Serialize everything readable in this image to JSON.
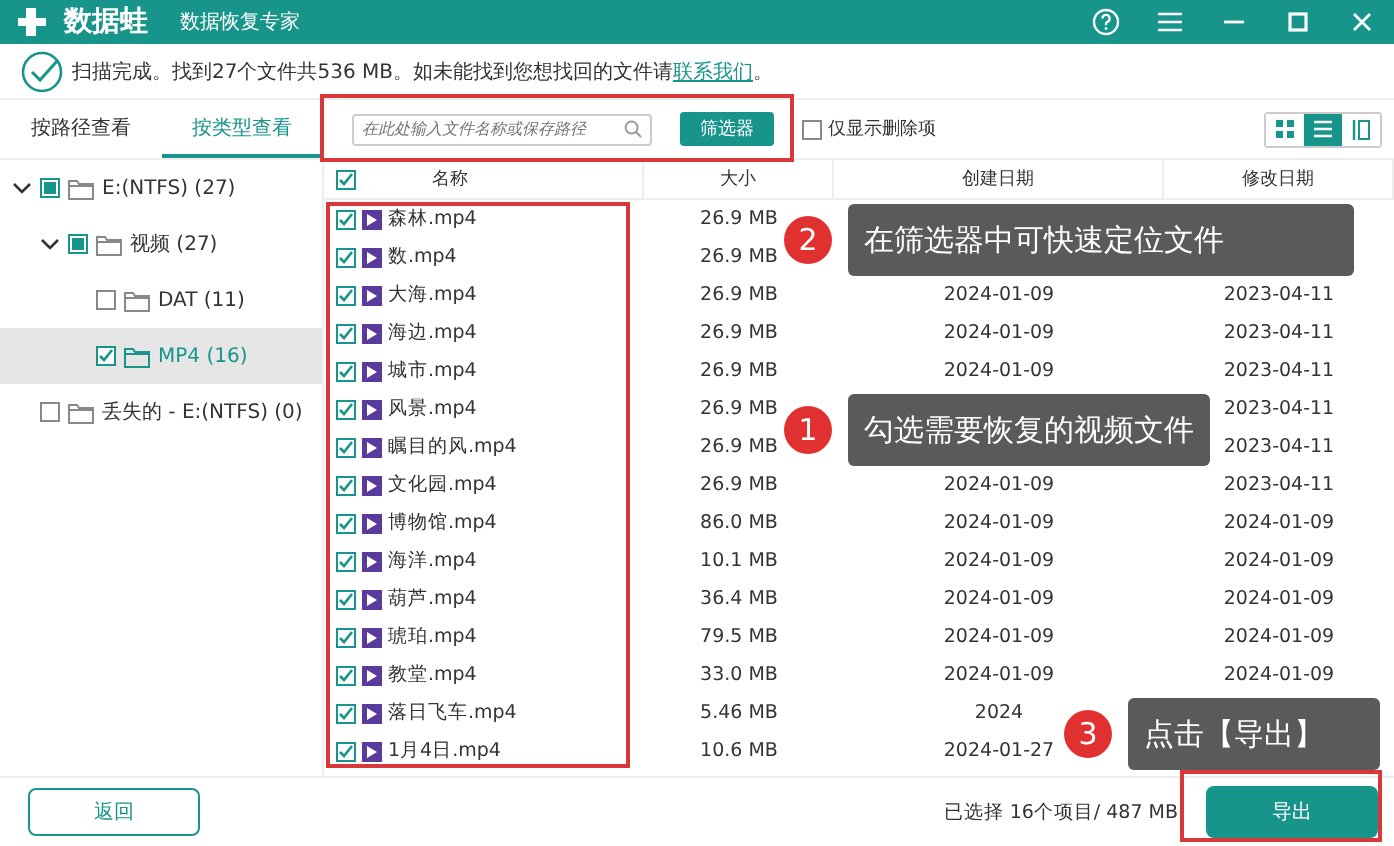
{
  "title_bar": {
    "app_name": "数据蛙",
    "subtitle": "数据恢复专家"
  },
  "status": {
    "text": "扫描完成。找到27个文件共536 MB。如未能找到您想找回的文件请",
    "link": "联系我们",
    "end": "。"
  },
  "view_tabs": [
    {
      "label": "按路径查看",
      "selected": false
    },
    {
      "label": "按类型查看",
      "selected": true
    }
  ],
  "tree": [
    {
      "label": "E:(NTFS) (27)",
      "checked": false,
      "partial": true,
      "expanded": true,
      "selected": false,
      "children": [
        {
          "label": "视频 (27)",
          "checked": false,
          "partial": true,
          "expanded": true,
          "selected": false,
          "children": [
            {
              "label": "DAT (11)",
              "checked": false,
              "partial": false,
              "selected": false
            },
            {
              "label": "MP4 (16)",
              "checked": true,
              "partial": false,
              "selected": true
            }
          ]
        }
      ]
    },
    {
      "label": "丢失的 - E:(NTFS) (0)",
      "checked": false,
      "partial": false,
      "selected": false
    }
  ],
  "filter": {
    "placeholder": "在此处输入文件名称或保存路径",
    "button": "筛选器",
    "only_deleted": {
      "label": "仅显示删除项",
      "checked": false
    }
  },
  "view_modes": [
    {
      "kind": "grid",
      "selected": false
    },
    {
      "kind": "list",
      "selected": true
    },
    {
      "kind": "detail",
      "selected": false
    }
  ],
  "table": {
    "select_all": true,
    "columns": [
      "名称",
      "大小",
      "创建日期",
      "修改日期"
    ],
    "rows": [
      {
        "name": "森林.mp4",
        "checked": true,
        "size": "26.9 MB"
      },
      {
        "name": "数.mp4",
        "checked": true,
        "size": "26.9 MB"
      },
      {
        "name": "大海.mp4",
        "checked": true,
        "size": "26.9 MB",
        "created": "2024-01-09",
        "modified": "2023-04-11"
      },
      {
        "name": "海边.mp4",
        "checked": true,
        "size": "26.9 MB",
        "created": "2024-01-09",
        "modified": "2023-04-11"
      },
      {
        "name": "城市.mp4",
        "checked": true,
        "size": "26.9 MB",
        "created": "2024-01-09",
        "modified": "2023-04-11"
      },
      {
        "name": "风景.mp4",
        "checked": true,
        "size": "26.9 MB",
        "modified": "2023-04-11"
      },
      {
        "name": "瞩目的风.mp4",
        "checked": true,
        "size": "26.9 MB",
        "modified": "2023-04-11"
      },
      {
        "name": "文化园.mp4",
        "checked": true,
        "size": "26.9 MB",
        "created": "2024-01-09",
        "modified": "2023-04-11"
      },
      {
        "name": "博物馆.mp4",
        "checked": true,
        "size": "86.0 MB",
        "created": "2024-01-09",
        "modified": "2024-01-09"
      },
      {
        "name": "海洋.mp4",
        "checked": true,
        "size": "10.1 MB",
        "created": "2024-01-09",
        "modified": "2024-01-09"
      },
      {
        "name": "葫芦.mp4",
        "checked": true,
        "size": "36.4 MB",
        "created": "2024-01-09",
        "modified": "2024-01-09"
      },
      {
        "name": "琥珀.mp4",
        "checked": true,
        "size": "79.5 MB",
        "created": "2024-01-09",
        "modified": "2024-01-09"
      },
      {
        "name": "教堂.mp4",
        "checked": true,
        "size": "33.0 MB",
        "created": "2024-01-09",
        "modified": "2024-01-09"
      },
      {
        "name": "落日飞车.mp4",
        "checked": true,
        "size": "5.46 MB",
        "created": "2024"
      },
      {
        "name": "1月4日.mp4",
        "checked": true,
        "size": "10.6 MB",
        "created": "2024-01-27"
      }
    ]
  },
  "footer": {
    "back_button": "返回",
    "selection": "已选择 16个项目/ 487 MB",
    "export_button": "导出"
  },
  "callouts": [
    {
      "number": "2",
      "text": "在筛选器中可快速定位文件"
    },
    {
      "number": "1",
      "text": "勾选需要恢复的视频文件"
    },
    {
      "number": "3",
      "text": "点击【导出】"
    }
  ]
}
